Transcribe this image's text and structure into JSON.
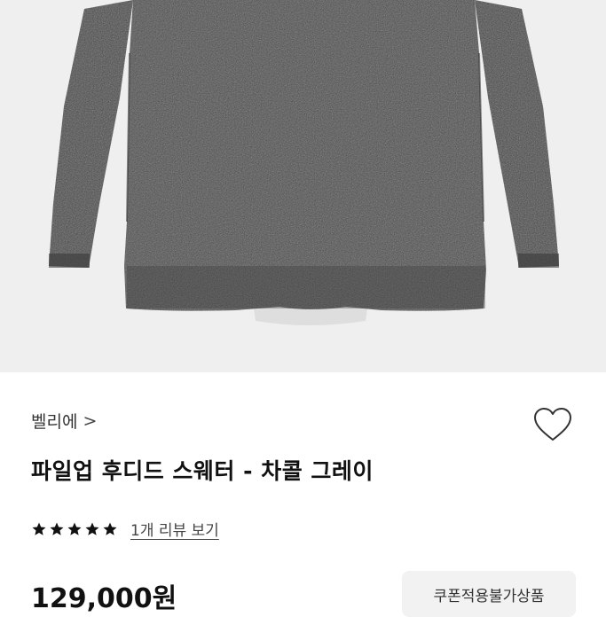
{
  "product": {
    "brand": "벨리에",
    "brand_chevron": ">",
    "title": "파일업 후디드 스웨터 - 차콜 그레이",
    "rating_stars": 5,
    "review_link": "1개 리뷰 보기",
    "price": "129,000원",
    "coupon_button": "쿠폰적용불가상품"
  },
  "icons": {
    "brand_chevron": "chevron-right-icon",
    "wishlist": "heart-outline-icon",
    "rating": "star-icon"
  },
  "colors": {
    "photo_background": "#efefef",
    "sweater": "#4a4a4a",
    "star": "#111111",
    "coupon_background": "#f2f2f2"
  }
}
